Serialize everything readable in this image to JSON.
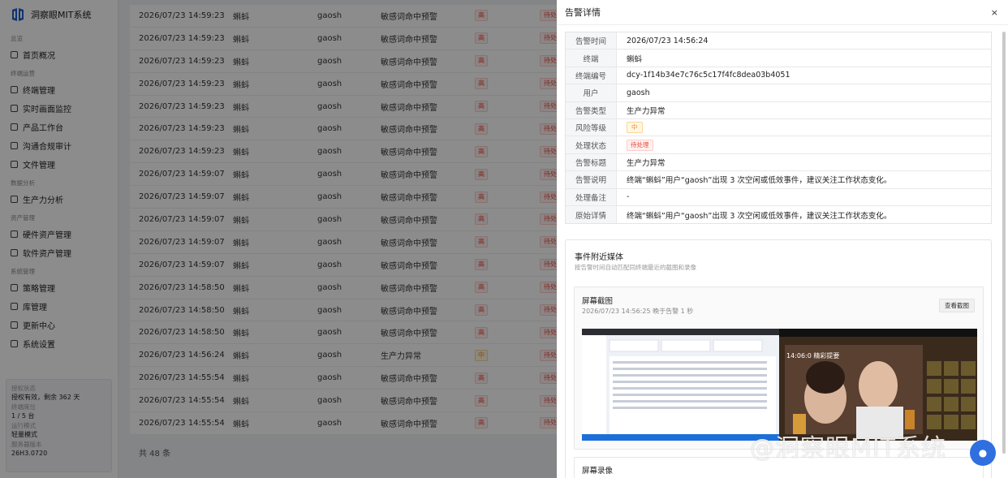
{
  "app": {
    "title": "洞察眼MIT系统"
  },
  "sidebar": {
    "groups": [
      {
        "label": "总览",
        "items": [
          {
            "label": "首页概况",
            "icon": "home-icon"
          }
        ]
      },
      {
        "label": "终端运营",
        "items": [
          {
            "label": "终端管理",
            "icon": "monitor-icon"
          },
          {
            "label": "实时画面监控",
            "icon": "eye-icon"
          },
          {
            "label": "产品工作台",
            "icon": "grid-icon"
          },
          {
            "label": "沟通合规审计",
            "icon": "shield-icon"
          },
          {
            "label": "文件管理",
            "icon": "file-icon"
          }
        ]
      },
      {
        "label": "数据分析",
        "items": [
          {
            "label": "生产力分析",
            "icon": "bar-chart-icon"
          }
        ]
      },
      {
        "label": "资产管理",
        "items": [
          {
            "label": "硬件资产管理",
            "icon": "server-icon"
          },
          {
            "label": "软件资产管理",
            "icon": "apps-icon"
          }
        ]
      },
      {
        "label": "系统管理",
        "items": [
          {
            "label": "策略管理",
            "icon": "gear-icon"
          },
          {
            "label": "库管理",
            "icon": "shield-icon"
          },
          {
            "label": "更新中心",
            "icon": "upload-icon"
          },
          {
            "label": "系统设置",
            "icon": "settings-icon"
          }
        ]
      }
    ],
    "license": {
      "status_label": "授权状态",
      "status_value": "授权有效，剩余 362 天",
      "terminal_label": "终端席位",
      "terminal_value": "1 / 5 台",
      "mode_label": "运行模式",
      "mode_value": "轻量模式",
      "version_label": "服务器版本",
      "version_value": "26H3.0720"
    }
  },
  "table": {
    "rows": [
      {
        "time": "2026/07/23 14:59:23",
        "terminal": "蝌蚪",
        "user": "gaosh",
        "type": "敏感词命中预警",
        "risk": "高",
        "risk_level": "high",
        "status": "待处"
      },
      {
        "time": "2026/07/23 14:59:23",
        "terminal": "蝌蚪",
        "user": "gaosh",
        "type": "敏感词命中预警",
        "risk": "高",
        "risk_level": "high",
        "status": "待处"
      },
      {
        "time": "2026/07/23 14:59:23",
        "terminal": "蝌蚪",
        "user": "gaosh",
        "type": "敏感词命中预警",
        "risk": "高",
        "risk_level": "high",
        "status": "待处"
      },
      {
        "time": "2026/07/23 14:59:23",
        "terminal": "蝌蚪",
        "user": "gaosh",
        "type": "敏感词命中预警",
        "risk": "高",
        "risk_level": "high",
        "status": "待处"
      },
      {
        "time": "2026/07/23 14:59:23",
        "terminal": "蝌蚪",
        "user": "gaosh",
        "type": "敏感词命中预警",
        "risk": "高",
        "risk_level": "high",
        "status": "待处"
      },
      {
        "time": "2026/07/23 14:59:23",
        "terminal": "蝌蚪",
        "user": "gaosh",
        "type": "敏感词命中预警",
        "risk": "高",
        "risk_level": "high",
        "status": "待处"
      },
      {
        "time": "2026/07/23 14:59:23",
        "terminal": "蝌蚪",
        "user": "gaosh",
        "type": "敏感词命中预警",
        "risk": "高",
        "risk_level": "high",
        "status": "待处"
      },
      {
        "time": "2026/07/23 14:59:07",
        "terminal": "蝌蚪",
        "user": "gaosh",
        "type": "敏感词命中预警",
        "risk": "高",
        "risk_level": "high",
        "status": "待处"
      },
      {
        "time": "2026/07/23 14:59:07",
        "terminal": "蝌蚪",
        "user": "gaosh",
        "type": "敏感词命中预警",
        "risk": "高",
        "risk_level": "high",
        "status": "待处"
      },
      {
        "time": "2026/07/23 14:59:07",
        "terminal": "蝌蚪",
        "user": "gaosh",
        "type": "敏感词命中预警",
        "risk": "高",
        "risk_level": "high",
        "status": "待处"
      },
      {
        "time": "2026/07/23 14:59:07",
        "terminal": "蝌蚪",
        "user": "gaosh",
        "type": "敏感词命中预警",
        "risk": "高",
        "risk_level": "high",
        "status": "待处"
      },
      {
        "time": "2026/07/23 14:59:07",
        "terminal": "蝌蚪",
        "user": "gaosh",
        "type": "敏感词命中预警",
        "risk": "高",
        "risk_level": "high",
        "status": "待处"
      },
      {
        "time": "2026/07/23 14:58:50",
        "terminal": "蝌蚪",
        "user": "gaosh",
        "type": "敏感词命中预警",
        "risk": "高",
        "risk_level": "high",
        "status": "待处"
      },
      {
        "time": "2026/07/23 14:58:50",
        "terminal": "蝌蚪",
        "user": "gaosh",
        "type": "敏感词命中预警",
        "risk": "高",
        "risk_level": "high",
        "status": "待处"
      },
      {
        "time": "2026/07/23 14:58:50",
        "terminal": "蝌蚪",
        "user": "gaosh",
        "type": "敏感词命中预警",
        "risk": "高",
        "risk_level": "high",
        "status": "待处"
      },
      {
        "time": "2026/07/23 14:56:24",
        "terminal": "蝌蚪",
        "user": "gaosh",
        "type": "生产力异常",
        "risk": "中",
        "risk_level": "mid",
        "status": "待处"
      },
      {
        "time": "2026/07/23 14:55:54",
        "terminal": "蝌蚪",
        "user": "gaosh",
        "type": "敏感词命中预警",
        "risk": "高",
        "risk_level": "high",
        "status": "待处"
      },
      {
        "time": "2026/07/23 14:55:54",
        "terminal": "蝌蚪",
        "user": "gaosh",
        "type": "敏感词命中预警",
        "risk": "高",
        "risk_level": "high",
        "status": "待处"
      },
      {
        "time": "2026/07/23 14:55:54",
        "terminal": "蝌蚪",
        "user": "gaosh",
        "type": "敏感词命中预警",
        "risk": "高",
        "risk_level": "high",
        "status": "待处"
      }
    ],
    "total": "共 48 条"
  },
  "drawer": {
    "title": "告警详情",
    "close": "×",
    "details": [
      {
        "label": "告警时间",
        "value": "2026/07/23 14:56:24"
      },
      {
        "label": "终端",
        "value": "蝌蚪"
      },
      {
        "label": "终端编号",
        "value": "dcy-1f14b34e7c76c5c17f4fc8dea03b4051"
      },
      {
        "label": "用户",
        "value": "gaosh"
      },
      {
        "label": "告警类型",
        "value": "生产力异常"
      },
      {
        "label": "风险等级",
        "value": "中",
        "tag": "mid"
      },
      {
        "label": "处理状态",
        "value": "待处理",
        "tag": "red"
      },
      {
        "label": "告警标题",
        "value": "生产力异常"
      },
      {
        "label": "告警说明",
        "value": "终端“蝌蚪”用户“gaosh”出现 3 次空闲或低效事件，建议关注工作状态变化。"
      },
      {
        "label": "处理备注",
        "value": "-"
      },
      {
        "label": "原始详情",
        "value": "终端“蝌蚪”用户“gaosh”出现 3 次空闲或低效事件，建议关注工作状态变化。"
      }
    ],
    "media": {
      "title": "事件附近媒体",
      "subtitle": "按告警时间自动匹配同终端最近的截图和录像",
      "screenshot": {
        "title": "屏幕截图",
        "meta": "2026/07/23 14:56:25  晚于告警 1 秒",
        "button": "查看截图",
        "thumb_text": "14:06:0 精彩提要"
      },
      "recording": {
        "title": "屏幕录像"
      }
    }
  },
  "watermark": "@洞察眼MIT系统",
  "colors": {
    "accent": "#2f6fe0",
    "danger": "#e84a3c",
    "warning": "#fa8c16"
  }
}
